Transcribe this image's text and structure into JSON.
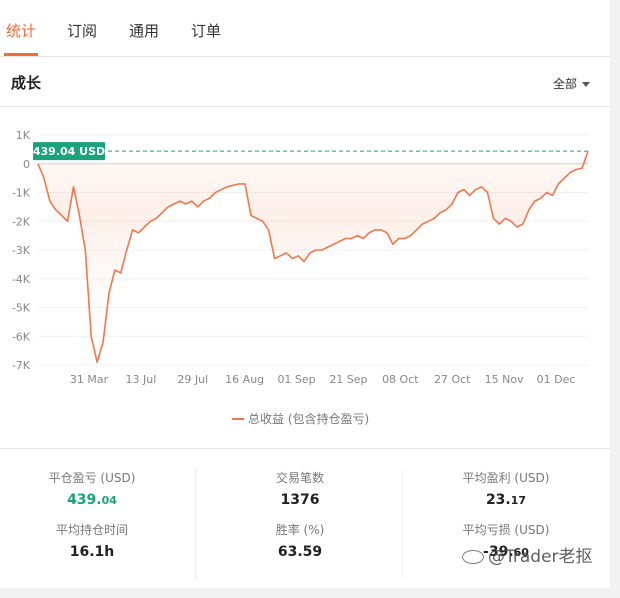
{
  "tabs": [
    "统计",
    "订阅",
    "通用",
    "订单"
  ],
  "section": {
    "title": "成长",
    "filter_label": "全部"
  },
  "chart_data": {
    "type": "area",
    "series": [
      {
        "name": "总收益 (包含持仓盈亏)",
        "color": "#f0784a",
        "values": [
          [
            0,
            0
          ],
          [
            1,
            -500
          ],
          [
            2,
            -1300
          ],
          [
            3,
            -1600
          ],
          [
            4,
            -1800
          ],
          [
            5,
            -2000
          ],
          [
            6,
            -800
          ],
          [
            7,
            -1800
          ],
          [
            8,
            -3000
          ],
          [
            9,
            -6000
          ],
          [
            10,
            -6900
          ],
          [
            11,
            -6200
          ],
          [
            12,
            -4500
          ],
          [
            13,
            -3700
          ],
          [
            14,
            -3800
          ],
          [
            15,
            -3000
          ],
          [
            16,
            -2300
          ],
          [
            17,
            -2400
          ],
          [
            18,
            -2200
          ],
          [
            19,
            -2000
          ],
          [
            20,
            -1900
          ],
          [
            21,
            -1700
          ],
          [
            22,
            -1500
          ],
          [
            23,
            -1400
          ],
          [
            24,
            -1300
          ],
          [
            25,
            -1400
          ],
          [
            26,
            -1300
          ],
          [
            27,
            -1500
          ],
          [
            28,
            -1300
          ],
          [
            29,
            -1200
          ],
          [
            30,
            -1000
          ],
          [
            31,
            -900
          ],
          [
            32,
            -800
          ],
          [
            33,
            -750
          ],
          [
            34,
            -700
          ],
          [
            35,
            -700
          ],
          [
            36,
            -1800
          ],
          [
            37,
            -1900
          ],
          [
            38,
            -2000
          ],
          [
            39,
            -2300
          ],
          [
            40,
            -3300
          ],
          [
            41,
            -3200
          ],
          [
            42,
            -3100
          ],
          [
            43,
            -3300
          ],
          [
            44,
            -3200
          ],
          [
            45,
            -3400
          ],
          [
            46,
            -3100
          ],
          [
            47,
            -3000
          ],
          [
            48,
            -3000
          ],
          [
            49,
            -2900
          ],
          [
            50,
            -2800
          ],
          [
            51,
            -2700
          ],
          [
            52,
            -2600
          ],
          [
            53,
            -2600
          ],
          [
            54,
            -2500
          ],
          [
            55,
            -2600
          ],
          [
            56,
            -2400
          ],
          [
            57,
            -2300
          ],
          [
            58,
            -2300
          ],
          [
            59,
            -2400
          ],
          [
            60,
            -2800
          ],
          [
            61,
            -2600
          ],
          [
            62,
            -2600
          ],
          [
            63,
            -2500
          ],
          [
            64,
            -2300
          ],
          [
            65,
            -2100
          ],
          [
            66,
            -2000
          ],
          [
            67,
            -1900
          ],
          [
            68,
            -1700
          ],
          [
            69,
            -1600
          ],
          [
            70,
            -1400
          ],
          [
            71,
            -1000
          ],
          [
            72,
            -900
          ],
          [
            73,
            -1100
          ],
          [
            74,
            -900
          ],
          [
            75,
            -800
          ],
          [
            76,
            -1000
          ],
          [
            77,
            -1900
          ],
          [
            78,
            -2100
          ],
          [
            79,
            -1900
          ],
          [
            80,
            -2000
          ],
          [
            81,
            -2200
          ],
          [
            82,
            -2100
          ],
          [
            83,
            -1600
          ],
          [
            84,
            -1300
          ],
          [
            85,
            -1200
          ],
          [
            86,
            -1000
          ],
          [
            87,
            -1100
          ],
          [
            88,
            -700
          ],
          [
            89,
            -500
          ],
          [
            90,
            -300
          ],
          [
            91,
            -200
          ],
          [
            92,
            -150
          ],
          [
            93,
            439.04
          ]
        ]
      }
    ],
    "x_tick_labels": [
      "31 Mar",
      "13 Jul",
      "29 Jul",
      "16 Aug",
      "01 Sep",
      "21 Sep",
      "08 Oct",
      "27 Oct",
      "15 Nov",
      "01 Dec"
    ],
    "y_tick_labels": [
      "1K",
      "0",
      "-1K",
      "-2K",
      "-3K",
      "-4K",
      "-5K",
      "-6K",
      "-7K"
    ],
    "ylim": [
      -7000,
      1000
    ],
    "last_value_label": "439.04 USD",
    "last_value": 439.04,
    "reference_line_color": "#1aa37a",
    "legend_position": "bottom"
  },
  "legend": {
    "label": "总收益 (包含持仓盈亏)"
  },
  "stats": {
    "closed_pnl": {
      "label": "平仓盈亏 (USD)",
      "int": "439.",
      "dec": "04"
    },
    "trades": {
      "label": "交易笔数",
      "value": "1376"
    },
    "avg_profit": {
      "label": "平均盈利 (USD)",
      "int": "23.",
      "dec": "17"
    },
    "avg_hold": {
      "label": "平均持仓时间",
      "value": "16.1h"
    },
    "win_rate": {
      "label": "胜率 (%)",
      "value": "63.59"
    },
    "avg_loss": {
      "label": "平均亏损 (USD)",
      "int": "-39.",
      "dec": "60"
    }
  },
  "watermark": "@Trader老抠",
  "colors": {
    "accent": "#f26b3a",
    "positive": "#1aa37a"
  }
}
